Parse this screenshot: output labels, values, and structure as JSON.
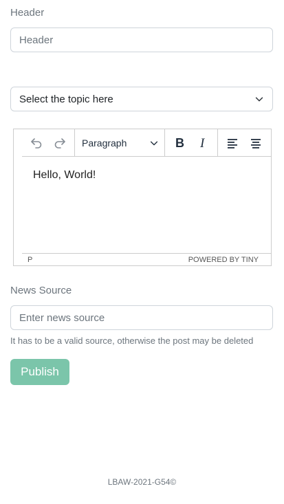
{
  "header": {
    "label": "Header",
    "placeholder": "Header"
  },
  "topic": {
    "selected": "Select the topic here"
  },
  "editor": {
    "block_format": "Paragraph",
    "content": "Hello, World!",
    "path": "P",
    "branding": "POWERED BY TINY"
  },
  "news_source": {
    "label": "News Source",
    "placeholder": "Enter news source",
    "help": "It has to be a valid source, otherwise the post may be deleted"
  },
  "actions": {
    "publish_label": "Publish"
  },
  "footer": {
    "text": "LBAW-2021-G54©"
  },
  "colors": {
    "accent": "#7bc5aa",
    "muted": "#6c757d",
    "border": "#ced4da"
  }
}
